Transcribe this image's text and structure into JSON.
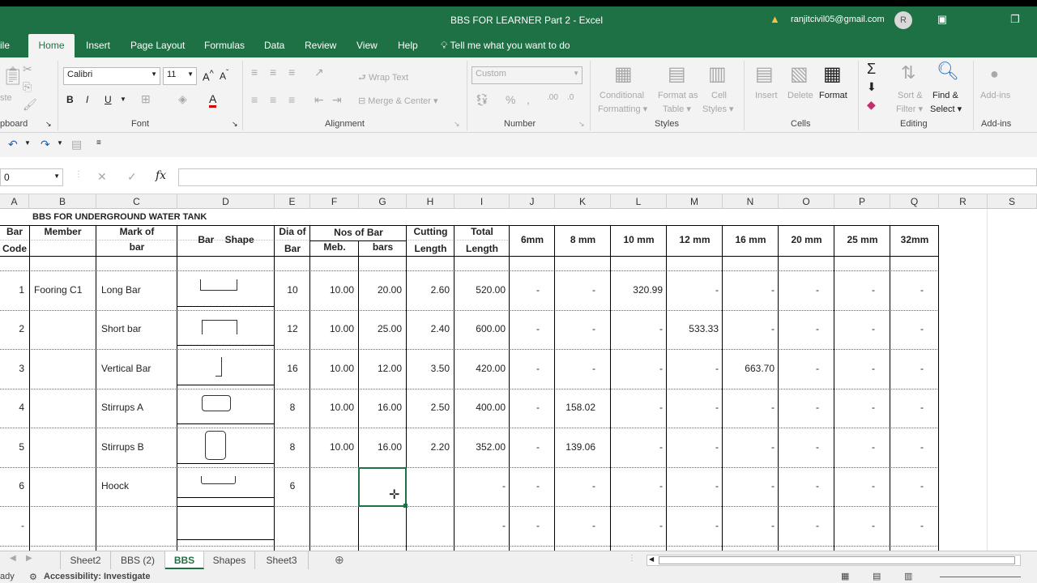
{
  "window": {
    "title": "BBS FOR LEARNER  Part 2  -  Excel",
    "account": "ranjitcivil05@gmail.com",
    "avatar_letter": "R"
  },
  "tabs": [
    "ile",
    "Home",
    "Insert",
    "Page Layout",
    "Formulas",
    "Data",
    "Review",
    "View",
    "Help"
  ],
  "tellme": "Tell me what you want to do",
  "ribbon": {
    "clipboard_label": "pboard",
    "paste_label": "ste",
    "font_label": "Font",
    "font_name": "Calibri",
    "font_size": "11",
    "bold": "B",
    "italic": "I",
    "underline": "U",
    "alignment_label": "Alignment",
    "wrap_text": "Wrap Text",
    "merge_center": "Merge & Center",
    "number_label": "Number",
    "number_format": "Custom",
    "styles_label": "Styles",
    "conditional": "Conditional",
    "formatting": "Formatting",
    "format_as": "Format as",
    "table": "Table",
    "cell": "Cell",
    "styles_word": "Styles",
    "cells_label": "Cells",
    "insert": "Insert",
    "delete": "Delete",
    "format": "Format",
    "editing_label": "Editing",
    "sort": "Sort &",
    "filter": "Filter",
    "find": "Find &",
    "select": "Select",
    "addins_label": "Add-ins",
    "addins": "Add-ins"
  },
  "namebox": "0",
  "columns": [
    "A",
    "B",
    "C",
    "D",
    "E",
    "F",
    "G",
    "H",
    "I",
    "J",
    "K",
    "L",
    "M",
    "N",
    "O",
    "P",
    "Q",
    "R",
    "S"
  ],
  "sheet": {
    "title": "BBS FOR UNDERGROUND WATER TANK",
    "headers": {
      "bar_code_1": "Bar",
      "bar_code_2": "Code",
      "member": "Member",
      "mark_1": "Mark of",
      "mark_2": "bar",
      "bar_shape": "Bar    Shape",
      "dia_1": "Dia of",
      "dia_2": "Bar",
      "nos": "Nos of Bar",
      "meb": "Meb.",
      "bars": "bars",
      "cut_1": "Cutting",
      "cut_2": "Length",
      "tot_1": "Total",
      "tot_2": "Length",
      "d6": "6mm",
      "d8": "8 mm",
      "d10": "10 mm",
      "d12": "12 mm",
      "d16": "16 mm",
      "d20": "20 mm",
      "d25": "25 mm",
      "d32": "32mm"
    },
    "rows": [
      {
        "code": "1",
        "member": "Fooring C1",
        "mark": "Long Bar",
        "dia": "10",
        "meb": "10.00",
        "bars": "20.00",
        "cut": "2.60",
        "total": "520.00",
        "w6": "-",
        "w8": "-",
        "w10": "320.99",
        "w12": "-",
        "w16": "-",
        "w20": "-",
        "w25": "-",
        "w32": "-"
      },
      {
        "code": "2",
        "member": "",
        "mark": "Short bar",
        "dia": "12",
        "meb": "10.00",
        "bars": "25.00",
        "cut": "2.40",
        "total": "600.00",
        "w6": "-",
        "w8": "-",
        "w10": "-",
        "w12": "533.33",
        "w16": "-",
        "w20": "-",
        "w25": "-",
        "w32": "-"
      },
      {
        "code": "3",
        "member": "",
        "mark": "Vertical Bar",
        "dia": "16",
        "meb": "10.00",
        "bars": "12.00",
        "cut": "3.50",
        "total": "420.00",
        "w6": "-",
        "w8": "-",
        "w10": "-",
        "w12": "-",
        "w16": "663.70",
        "w20": "-",
        "w25": "-",
        "w32": "-"
      },
      {
        "code": "4",
        "member": "",
        "mark": "Stirrups A",
        "dia": "8",
        "meb": "10.00",
        "bars": "16.00",
        "cut": "2.50",
        "total": "400.00",
        "w6": "-",
        "w8": "158.02",
        "w10": "-",
        "w12": "-",
        "w16": "-",
        "w20": "-",
        "w25": "-",
        "w32": "-"
      },
      {
        "code": "5",
        "member": "",
        "mark": "Stirrups B",
        "dia": "8",
        "meb": "10.00",
        "bars": "16.00",
        "cut": "2.20",
        "total": "352.00",
        "w6": "-",
        "w8": "139.06",
        "w10": "-",
        "w12": "-",
        "w16": "-",
        "w20": "-",
        "w25": "-",
        "w32": "-"
      },
      {
        "code": "6",
        "member": "",
        "mark": "Hoock",
        "dia": "6",
        "meb": "",
        "bars": "",
        "cut": "",
        "total": "-",
        "w6": "-",
        "w8": "-",
        "w10": "-",
        "w12": "-",
        "w16": "-",
        "w20": "-",
        "w25": "-",
        "w32": "-"
      },
      {
        "code": "-",
        "member": "",
        "mark": "",
        "dia": "",
        "meb": "",
        "bars": "",
        "cut": "",
        "total": "-",
        "w6": "-",
        "w8": "-",
        "w10": "-",
        "w12": "-",
        "w16": "-",
        "w20": "-",
        "w25": "-",
        "w32": "-"
      }
    ]
  },
  "sheet_tabs": [
    "Sheet2",
    "BBS (2)",
    "BBS",
    "Shapes",
    "Sheet3"
  ],
  "active_sheet": "BBS",
  "status": {
    "ready": "ady",
    "accessibility": "Accessibility: Investigate"
  },
  "colors": {
    "excel_green": "#1e7145",
    "ribbon_bg": "#f3f3f3",
    "grid_line": "#e2e2e2"
  }
}
